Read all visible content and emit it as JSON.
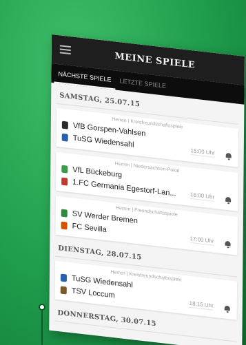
{
  "header": {
    "title": "MEINE SPIELE"
  },
  "tabs": [
    {
      "label": "NÄCHSTE SPIELE",
      "active": true
    },
    {
      "label": "LETZTE SPIELE",
      "active": false
    }
  ],
  "days": [
    {
      "label": "SAMSTAG, 25.07.15",
      "matches": [
        {
          "competition": "Herren | Kreisfreundschaftsspiele",
          "home": "VfB Gorspen-Vahlsen",
          "away": "TuSG Wiedensahl",
          "time": "15:00 Uhr"
        },
        {
          "competition": "Herren | Niedersachsen-Pokal",
          "home": "VfL Bückeburg",
          "away": "1.FC Germania Egestorf-Lan...",
          "time": "16:00 Uhr"
        },
        {
          "competition": "Herren | Freundschaftsspiele",
          "home": "SV Werder Bremen",
          "away": "FC Sevilla",
          "time": "17:00 Uhr"
        }
      ]
    },
    {
      "label": "DIENSTAG, 28.07.15",
      "matches": [
        {
          "competition": "Herren | Kreisfreundschaftsspiele",
          "home": "TuSG Wiedensahl",
          "away": "TSV Loccum",
          "time": "18:15 Uhr"
        }
      ]
    },
    {
      "label": "DONNERSTAG, 30.07.15",
      "matches": []
    }
  ],
  "colors": {
    "background": "#1f9c4c",
    "appbar": "#1e1e1e",
    "tabbar": "#0d0d0d",
    "crests": [
      "#2b2b2b",
      "#2a5fb0",
      "#3a9b48",
      "#c0392b",
      "#2e8b3e",
      "#d35400",
      "#2a5fb0",
      "#7a5a2a"
    ]
  },
  "icons": {
    "menu": "hamburger-menu-icon",
    "notify": "bell-icon"
  }
}
